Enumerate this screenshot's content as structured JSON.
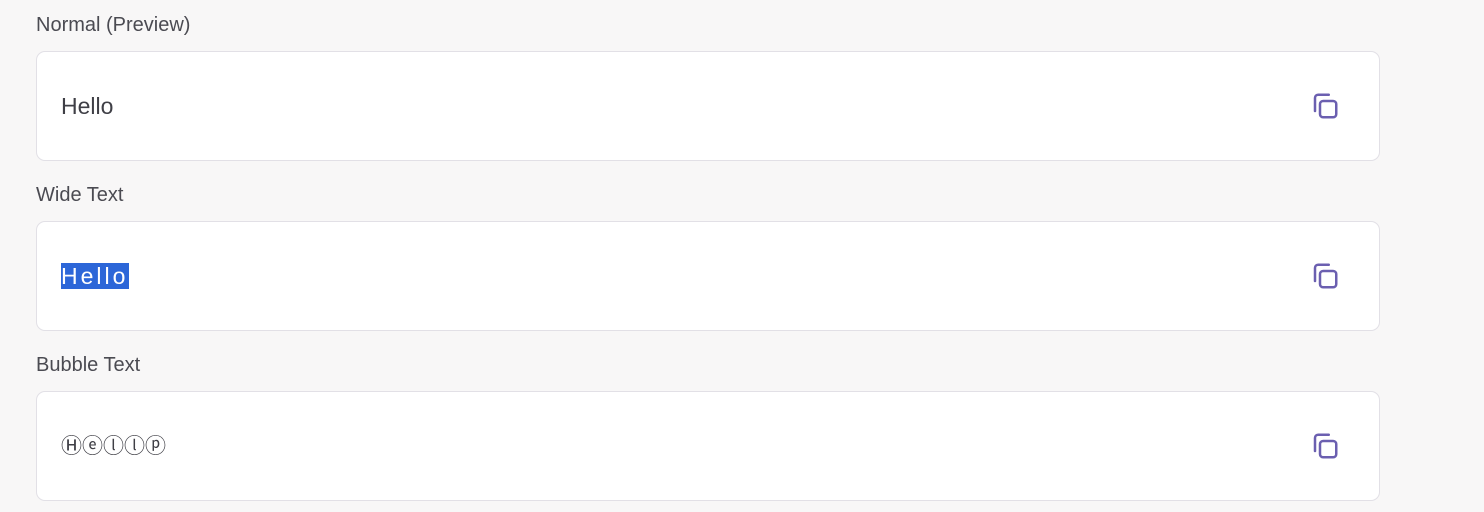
{
  "sections": [
    {
      "label": "Normal (Preview)",
      "text": "Hello"
    },
    {
      "label": "Wide Text",
      "text": "Hello"
    },
    {
      "label": "Bubble Text",
      "text": "Ⓗⓔⓛⓛⓟ"
    }
  ],
  "icons": {
    "copy": "copy-icon"
  },
  "colors": {
    "background": "#f8f7f7",
    "card": "#ffffff",
    "card_border": "#e2e0e6",
    "icon": "#6b5fb0",
    "selection": "#2c66d8"
  }
}
